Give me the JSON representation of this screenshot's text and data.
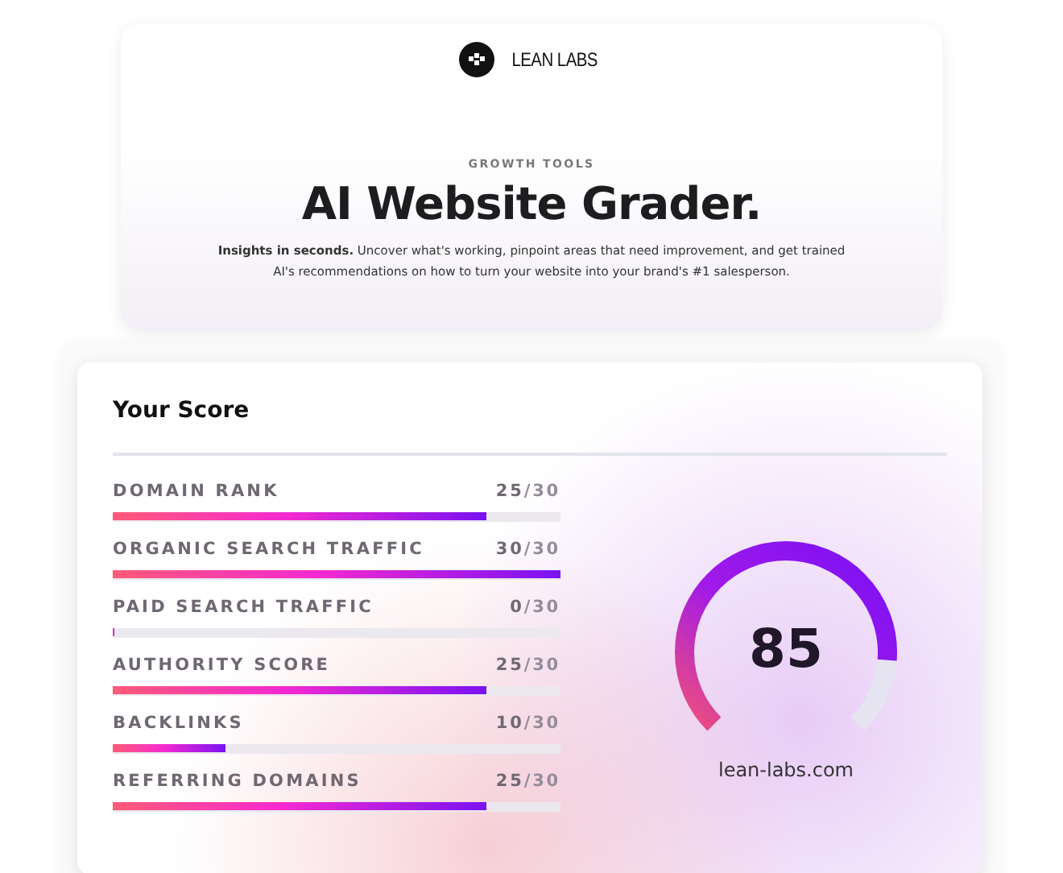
{
  "header": {
    "logo_text": "LEAN LABS",
    "eyebrow": "GROWTH TOOLS",
    "title": "AI Website Grader.",
    "intro": "**Insights in seconds.** Uncover what's working, pinpoint areas that need improvement, and get trained AI's recommendations on how to turn your website into your brand's #1 salesperson."
  },
  "score_card": {
    "title": "Your Score",
    "metrics": [
      {
        "label": "DOMAIN RANK",
        "score": "25",
        "max": "/30",
        "level": 0.833
      },
      {
        "label": "ORGANIC SEARCH TRAFFIC",
        "score": "30",
        "max": "/30",
        "level": 1
      },
      {
        "label": "PAID SEARCH TRAFFIC",
        "score": "0",
        "max": "/30",
        "level": 0
      },
      {
        "label": "AUTHORITY SCORE",
        "score": "25",
        "max": "/30",
        "level": 0.833
      },
      {
        "label": "BACKLINKS",
        "score": "10",
        "max": "/30",
        "level": 0.25
      },
      {
        "label": "REFERRING DOMAINS",
        "score": "25",
        "max": "/30",
        "level": 0.833
      }
    ],
    "gauge": {
      "value": "85",
      "domain": "lean-labs.com"
    }
  }
}
